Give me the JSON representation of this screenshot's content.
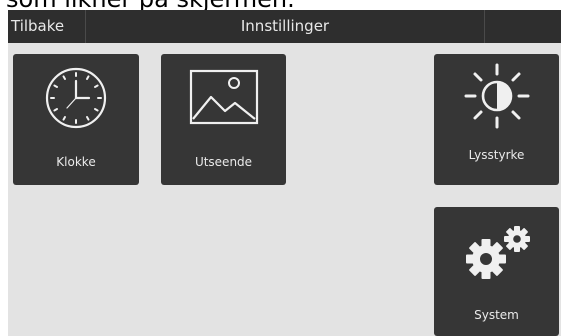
{
  "caption": "som likner på skjermen.",
  "topbar": {
    "back_label": "Tilbake",
    "title": "Innstillinger"
  },
  "tiles": [
    {
      "label": "Klokke",
      "icon": "clock-icon"
    },
    {
      "label": "Utseende",
      "icon": "image-icon"
    },
    {
      "label": "Lysstyrke",
      "icon": "brightness-icon"
    },
    {
      "label": "System",
      "icon": "gears-icon"
    }
  ],
  "colors": {
    "screen_bg": "#e3e3e3",
    "bar_bg": "#2e2e2e",
    "tile_bg": "#363636",
    "text": "#f0f0f0"
  }
}
